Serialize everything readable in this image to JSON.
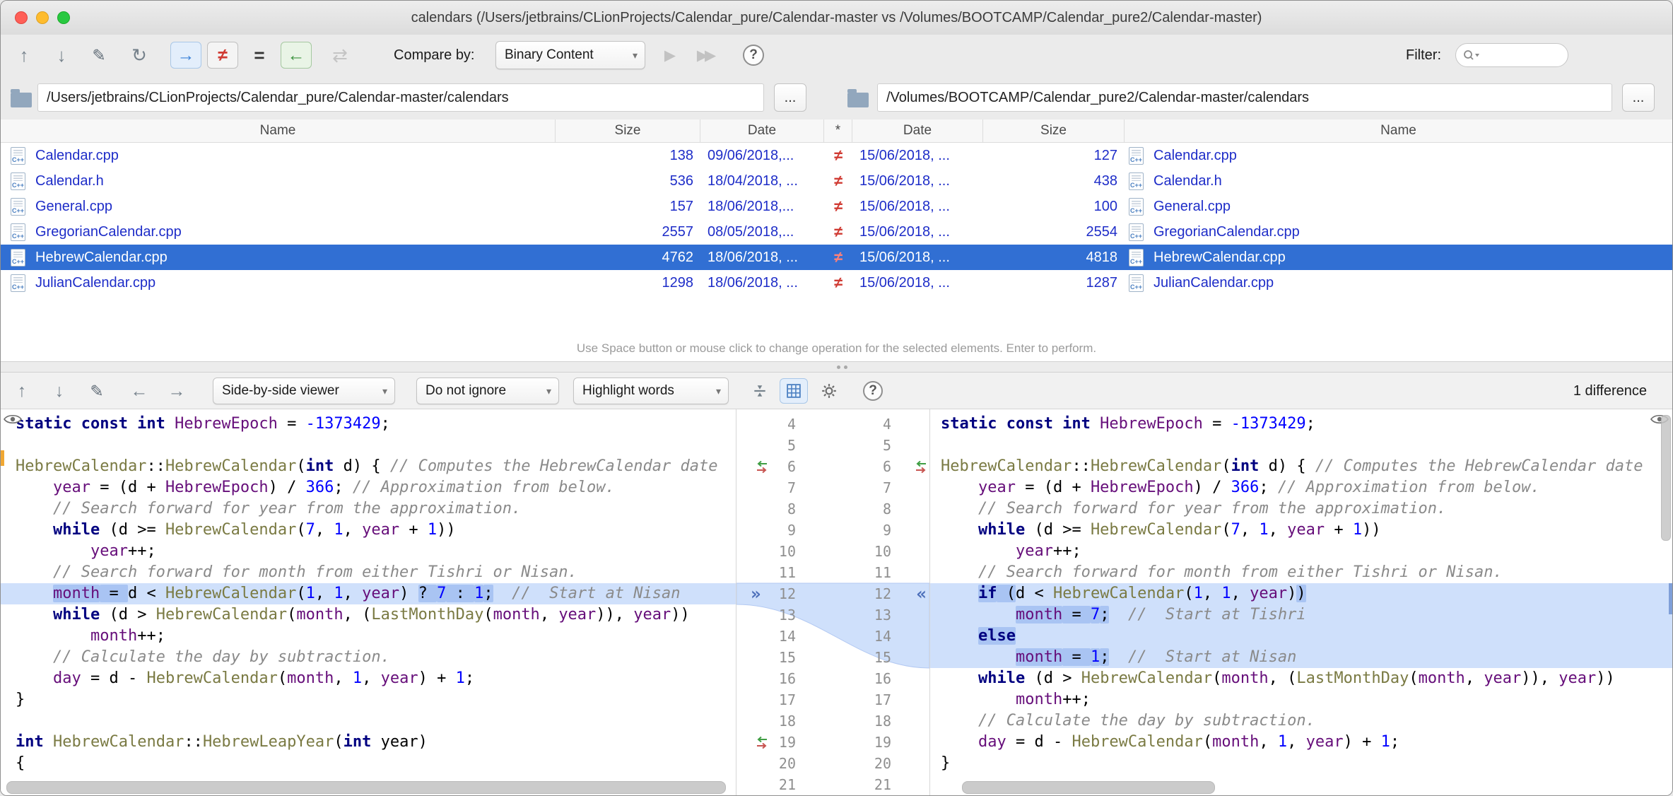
{
  "window": {
    "title": "calendars (/Users/jetbrains/CLionProjects/Calendar_pure/Calendar-master vs /Volumes/BOOTCAMP/Calendar_pure2/Calendar-master)"
  },
  "colors": {
    "selection_blue": "#316fd3",
    "file_blue": "#1e2dc8",
    "neq_red": "#d03b33",
    "diff_line_bg": "#cfe0fb",
    "diff_word_bg": "#a9c4f3"
  },
  "icons": {
    "up": "↑",
    "down": "↓",
    "edit": "✎",
    "refresh": "↻",
    "arrow_right": "→",
    "neq": "≠",
    "eq": "=",
    "arrow_left": "←",
    "swap": "⇄",
    "play": "▶",
    "fast": "▶▶",
    "help": "?",
    "caret": "▾",
    "chev_right": "»",
    "chev_left": "«",
    "file_icon_label": "C++"
  },
  "toolbar": {
    "compare_by_label": "Compare by:",
    "compare_by_value": "Binary Content",
    "filter_label": "Filter:"
  },
  "paths": {
    "left": "/Users/jetbrains/CLionProjects/Calendar_pure/Calendar-master/calendars",
    "right": "/Volumes/BOOTCAMP/Calendar_pure2/Calendar-master/calendars",
    "browse": "..."
  },
  "table": {
    "headers": [
      "Name",
      "Size",
      "Date",
      "*",
      "Date",
      "Size",
      "Name"
    ],
    "rows": [
      {
        "left_name": "Calendar.cpp",
        "left_size": "138",
        "left_date": "09/06/2018,...",
        "op": "≠",
        "right_date": "15/06/2018, ...",
        "right_size": "127",
        "right_name": "Calendar.cpp",
        "selected": false
      },
      {
        "left_name": "Calendar.h",
        "left_size": "536",
        "left_date": "18/04/2018, ...",
        "op": "≠",
        "right_date": "15/06/2018, ...",
        "right_size": "438",
        "right_name": "Calendar.h",
        "selected": false
      },
      {
        "left_name": "General.cpp",
        "left_size": "157",
        "left_date": "18/06/2018,...",
        "op": "≠",
        "right_date": "15/06/2018, ...",
        "right_size": "100",
        "right_name": "General.cpp",
        "selected": false
      },
      {
        "left_name": "GregorianCalendar.cpp",
        "left_size": "2557",
        "left_date": "08/05/2018,...",
        "op": "≠",
        "right_date": "15/06/2018, ...",
        "right_size": "2554",
        "right_name": "GregorianCalendar.cpp",
        "selected": false
      },
      {
        "left_name": "HebrewCalendar.cpp",
        "left_size": "4762",
        "left_date": "18/06/2018, ...",
        "op": "≠",
        "right_date": "15/06/2018, ...",
        "right_size": "4818",
        "right_name": "HebrewCalendar.cpp",
        "selected": true
      },
      {
        "left_name": "JulianCalendar.cpp",
        "left_size": "1298",
        "left_date": "18/06/2018, ...",
        "op": "≠",
        "right_date": "15/06/2018, ...",
        "right_size": "1287",
        "right_name": "JulianCalendar.cpp",
        "selected": false
      }
    ]
  },
  "hint": "Use Space button or mouse click to change operation for the selected elements. Enter to perform.",
  "diff_toolbar": {
    "viewer": "Side-by-side viewer",
    "ignore_policy": "Do not ignore",
    "highlight_policy": "Highlight words",
    "status": "1 difference"
  },
  "diff": {
    "left": [
      {
        "n": 4,
        "t": [
          [
            "k",
            "static const int"
          ],
          [
            "p",
            " "
          ],
          [
            "v",
            "HebrewEpoch"
          ],
          [
            "p",
            " = "
          ],
          [
            "n",
            "-1373429"
          ],
          [
            "p",
            ";"
          ]
        ]
      },
      {
        "n": 5,
        "t": []
      },
      {
        "n": 6,
        "t": [
          [
            "f",
            "HebrewCalendar"
          ],
          [
            "p",
            "::"
          ],
          [
            "f",
            "HebrewCalendar"
          ],
          [
            "p",
            "("
          ],
          [
            "k",
            "int"
          ],
          [
            "p",
            " d) { "
          ],
          [
            "c",
            "// Computes the HebrewCalendar date"
          ]
        ]
      },
      {
        "n": 7,
        "t": [
          [
            "p",
            "    "
          ],
          [
            "v",
            "year"
          ],
          [
            "p",
            " = (d + "
          ],
          [
            "v",
            "HebrewEpoch"
          ],
          [
            "p",
            ") / "
          ],
          [
            "n",
            "366"
          ],
          [
            "p",
            "; "
          ],
          [
            "c",
            "// Approximation from below."
          ]
        ]
      },
      {
        "n": 8,
        "t": [
          [
            "p",
            "    "
          ],
          [
            "c",
            "// Search forward for year from the approximation."
          ]
        ]
      },
      {
        "n": 9,
        "t": [
          [
            "p",
            "    "
          ],
          [
            "k",
            "while"
          ],
          [
            "p",
            " (d >= "
          ],
          [
            "f",
            "HebrewCalendar"
          ],
          [
            "p",
            "("
          ],
          [
            "n",
            "7"
          ],
          [
            "p",
            ", "
          ],
          [
            "n",
            "1"
          ],
          [
            "p",
            ", "
          ],
          [
            "v",
            "year"
          ],
          [
            "p",
            " + "
          ],
          [
            "n",
            "1"
          ],
          [
            "p",
            "))"
          ]
        ]
      },
      {
        "n": 10,
        "t": [
          [
            "p",
            "        "
          ],
          [
            "v",
            "year"
          ],
          [
            "p",
            "++;"
          ]
        ]
      },
      {
        "n": 11,
        "t": [
          [
            "p",
            "    "
          ],
          [
            "c",
            "// Search forward for month from either Tishri or Nisan."
          ]
        ]
      },
      {
        "n": 12,
        "h": 1,
        "t": [
          [
            "p",
            "    "
          ],
          [
            "v",
            "month",
            1
          ],
          [
            "p",
            " = ",
            1
          ],
          [
            "p",
            "d < "
          ],
          [
            "f",
            "HebrewCalendar"
          ],
          [
            "p",
            "("
          ],
          [
            "n",
            "1"
          ],
          [
            "p",
            ", "
          ],
          [
            "n",
            "1"
          ],
          [
            "p",
            ", "
          ],
          [
            "v",
            "year"
          ],
          [
            "p",
            ") "
          ],
          [
            "p",
            "? ",
            1
          ],
          [
            "n",
            "7",
            1
          ],
          [
            "p",
            " : ",
            1
          ],
          [
            "n",
            "1",
            1
          ],
          [
            "p",
            ";",
            1
          ],
          [
            "c",
            "  //  Start at Nisan"
          ]
        ]
      },
      {
        "n": 13,
        "t": [
          [
            "p",
            "    "
          ],
          [
            "k",
            "while"
          ],
          [
            "p",
            " (d > "
          ],
          [
            "f",
            "HebrewCalendar"
          ],
          [
            "p",
            "("
          ],
          [
            "v",
            "month"
          ],
          [
            "p",
            ", ("
          ],
          [
            "f",
            "LastMonthDay"
          ],
          [
            "p",
            "("
          ],
          [
            "v",
            "month"
          ],
          [
            "p",
            ", "
          ],
          [
            "v",
            "year"
          ],
          [
            "p",
            ")), "
          ],
          [
            "v",
            "year"
          ],
          [
            "p",
            "))"
          ]
        ]
      },
      {
        "n": 14,
        "t": [
          [
            "p",
            "        "
          ],
          [
            "v",
            "month"
          ],
          [
            "p",
            "++;"
          ]
        ]
      },
      {
        "n": 15,
        "t": [
          [
            "p",
            "    "
          ],
          [
            "c",
            "// Calculate the day by subtraction."
          ]
        ]
      },
      {
        "n": 16,
        "t": [
          [
            "p",
            "    "
          ],
          [
            "v",
            "day"
          ],
          [
            "p",
            " = d - "
          ],
          [
            "f",
            "HebrewCalendar"
          ],
          [
            "p",
            "("
          ],
          [
            "v",
            "month"
          ],
          [
            "p",
            ", "
          ],
          [
            "n",
            "1"
          ],
          [
            "p",
            ", "
          ],
          [
            "v",
            "year"
          ],
          [
            "p",
            ") + "
          ],
          [
            "n",
            "1"
          ],
          [
            "p",
            ";"
          ]
        ]
      },
      {
        "n": 17,
        "t": [
          [
            "p",
            "}"
          ]
        ]
      },
      {
        "n": 18,
        "t": []
      },
      {
        "n": 19,
        "t": [
          [
            "k",
            "int"
          ],
          [
            "p",
            " "
          ],
          [
            "f",
            "HebrewCalendar"
          ],
          [
            "p",
            "::"
          ],
          [
            "f",
            "HebrewLeapYear"
          ],
          [
            "p",
            "("
          ],
          [
            "k",
            "int"
          ],
          [
            "p",
            " year)"
          ]
        ]
      },
      {
        "n": 20,
        "t": [
          [
            "p",
            "{"
          ]
        ]
      },
      {
        "n": 21,
        "t": []
      }
    ],
    "right": [
      {
        "n": 4,
        "t": [
          [
            "k",
            "static const int"
          ],
          [
            "p",
            " "
          ],
          [
            "v",
            "HebrewEpoch"
          ],
          [
            "p",
            " = "
          ],
          [
            "n",
            "-1373429"
          ],
          [
            "p",
            ";"
          ]
        ]
      },
      {
        "n": 5,
        "t": []
      },
      {
        "n": 6,
        "t": [
          [
            "f",
            "HebrewCalendar"
          ],
          [
            "p",
            "::"
          ],
          [
            "f",
            "HebrewCalendar"
          ],
          [
            "p",
            "("
          ],
          [
            "k",
            "int"
          ],
          [
            "p",
            " d) { "
          ],
          [
            "c",
            "// Computes the HebrewCalendar date"
          ]
        ]
      },
      {
        "n": 7,
        "t": [
          [
            "p",
            "    "
          ],
          [
            "v",
            "year"
          ],
          [
            "p",
            " = (d + "
          ],
          [
            "v",
            "HebrewEpoch"
          ],
          [
            "p",
            ") / "
          ],
          [
            "n",
            "366"
          ],
          [
            "p",
            "; "
          ],
          [
            "c",
            "// Approximation from below."
          ]
        ]
      },
      {
        "n": 8,
        "t": [
          [
            "p",
            "    "
          ],
          [
            "c",
            "// Search forward for year from the approximation."
          ]
        ]
      },
      {
        "n": 9,
        "t": [
          [
            "p",
            "    "
          ],
          [
            "k",
            "while"
          ],
          [
            "p",
            " (d >= "
          ],
          [
            "f",
            "HebrewCalendar"
          ],
          [
            "p",
            "("
          ],
          [
            "n",
            "7"
          ],
          [
            "p",
            ", "
          ],
          [
            "n",
            "1"
          ],
          [
            "p",
            ", "
          ],
          [
            "v",
            "year"
          ],
          [
            "p",
            " + "
          ],
          [
            "n",
            "1"
          ],
          [
            "p",
            "))"
          ]
        ]
      },
      {
        "n": 10,
        "t": [
          [
            "p",
            "        "
          ],
          [
            "v",
            "year"
          ],
          [
            "p",
            "++;"
          ]
        ]
      },
      {
        "n": 11,
        "t": [
          [
            "p",
            "    "
          ],
          [
            "c",
            "// Search forward for month from either Tishri or Nisan."
          ]
        ]
      },
      {
        "n": 12,
        "h": 1,
        "t": [
          [
            "p",
            "    "
          ],
          [
            "k",
            "if",
            1
          ],
          [
            "p",
            " (",
            1
          ],
          [
            "p",
            "d < "
          ],
          [
            "f",
            "HebrewCalendar"
          ],
          [
            "p",
            "("
          ],
          [
            "n",
            "1"
          ],
          [
            "p",
            ", "
          ],
          [
            "n",
            "1"
          ],
          [
            "p",
            ", "
          ],
          [
            "v",
            "year"
          ],
          [
            "p",
            ")"
          ],
          [
            "p",
            ")",
            1
          ]
        ]
      },
      {
        "n": 13,
        "h": 1,
        "t": [
          [
            "p",
            "        "
          ],
          [
            "v",
            "month",
            1
          ],
          [
            "p",
            " = ",
            1
          ],
          [
            "n",
            "7",
            1
          ],
          [
            "p",
            ";",
            1
          ],
          [
            "c",
            "  //  Start at Tishri"
          ]
        ]
      },
      {
        "n": 14,
        "h": 1,
        "t": [
          [
            "p",
            "    "
          ],
          [
            "k",
            "else",
            1
          ]
        ]
      },
      {
        "n": 15,
        "h": 1,
        "t": [
          [
            "p",
            "        "
          ],
          [
            "v",
            "month",
            1
          ],
          [
            "p",
            " = ",
            1
          ],
          [
            "n",
            "1",
            1
          ],
          [
            "p",
            ";",
            1
          ],
          [
            "c",
            "  //  Start at Nisan"
          ]
        ]
      },
      {
        "n": 16,
        "t": [
          [
            "p",
            "    "
          ],
          [
            "k",
            "while"
          ],
          [
            "p",
            " (d > "
          ],
          [
            "f",
            "HebrewCalendar"
          ],
          [
            "p",
            "("
          ],
          [
            "v",
            "month"
          ],
          [
            "p",
            ", ("
          ],
          [
            "f",
            "LastMonthDay"
          ],
          [
            "p",
            "("
          ],
          [
            "v",
            "month"
          ],
          [
            "p",
            ", "
          ],
          [
            "v",
            "year"
          ],
          [
            "p",
            ")), "
          ],
          [
            "v",
            "year"
          ],
          [
            "p",
            "))"
          ]
        ]
      },
      {
        "n": 17,
        "t": [
          [
            "p",
            "        "
          ],
          [
            "v",
            "month"
          ],
          [
            "p",
            "++;"
          ]
        ]
      },
      {
        "n": 18,
        "t": [
          [
            "p",
            "    "
          ],
          [
            "c",
            "// Calculate the day by subtraction."
          ]
        ]
      },
      {
        "n": 19,
        "t": [
          [
            "p",
            "    "
          ],
          [
            "v",
            "day"
          ],
          [
            "p",
            " = d - "
          ],
          [
            "f",
            "HebrewCalendar"
          ],
          [
            "p",
            "("
          ],
          [
            "v",
            "month"
          ],
          [
            "p",
            ", "
          ],
          [
            "n",
            "1"
          ],
          [
            "p",
            ", "
          ],
          [
            "v",
            "year"
          ],
          [
            "p",
            ") + "
          ],
          [
            "n",
            "1"
          ],
          [
            "p",
            ";"
          ]
        ]
      },
      {
        "n": 20,
        "t": [
          [
            "p",
            "}"
          ]
        ]
      },
      {
        "n": 21,
        "t": []
      }
    ],
    "markers": [
      {
        "line": 6,
        "left": "transfer",
        "right": "transfer"
      },
      {
        "line": 12,
        "left": "chev_right",
        "right": "chev_left"
      },
      {
        "line": 19,
        "left": "transfer"
      }
    ]
  }
}
